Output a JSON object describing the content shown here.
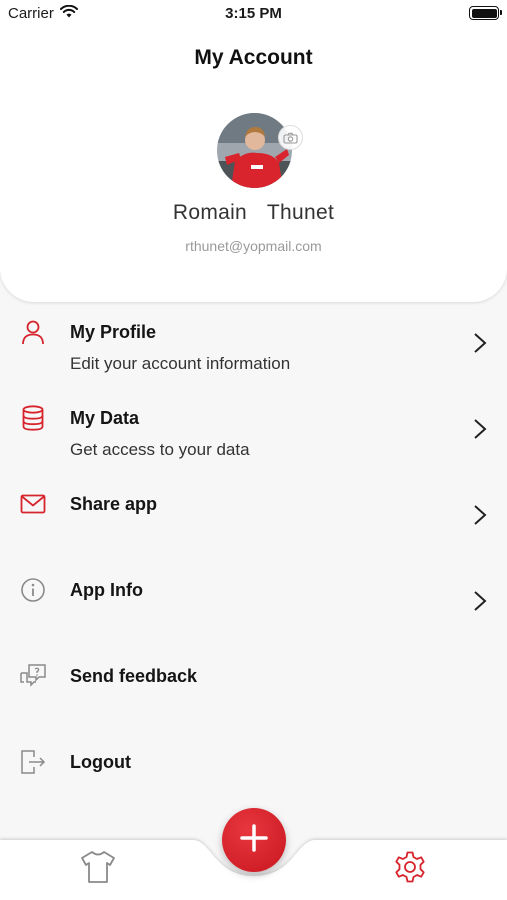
{
  "status_bar": {
    "carrier": "Carrier",
    "time": "3:15 PM"
  },
  "header": {
    "title": "My Account",
    "user_name": "Romain  Thunet",
    "user_email": "rthunet@yopmail.com"
  },
  "menu": {
    "items": [
      {
        "title": "My Profile",
        "subtitle": "Edit your account information",
        "icon": "user-icon",
        "chevron": true
      },
      {
        "title": "My Data",
        "subtitle": "Get access to your data",
        "icon": "database-icon",
        "chevron": true
      },
      {
        "title": "Share app",
        "subtitle": "",
        "icon": "mail-icon",
        "chevron": true
      },
      {
        "title": "App Info",
        "subtitle": "",
        "icon": "info-icon",
        "chevron": true
      },
      {
        "title": "Send feedback",
        "subtitle": "",
        "icon": "feedback-icon",
        "chevron": false
      },
      {
        "title": "Logout",
        "subtitle": "",
        "icon": "logout-icon",
        "chevron": false
      }
    ]
  },
  "tab_bar": {
    "left_icon": "shirt-icon",
    "center_icon": "plus-icon",
    "right_icon": "gear-icon"
  },
  "colors": {
    "accent": "#d7242c",
    "icon_gray": "#8a8a8a",
    "background": "#f7f7f7",
    "card": "#ffffff"
  }
}
